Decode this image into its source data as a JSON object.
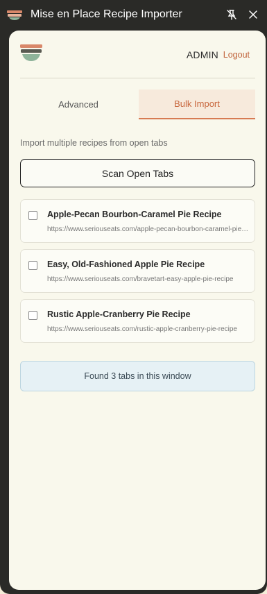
{
  "window": {
    "title": "Mise en Place Recipe Importer"
  },
  "header": {
    "user": "ADMIN",
    "logout_label": "Logout"
  },
  "tabs": [
    {
      "label": "Advanced",
      "active": false
    },
    {
      "label": "Bulk Import",
      "active": true
    }
  ],
  "bulk": {
    "intro": "Import multiple recipes from open tabs",
    "scan_label": "Scan Open Tabs",
    "tabs_found": [
      {
        "title": "Apple-Pecan Bourbon-Caramel Pie Recipe",
        "url": "https://www.seriouseats.com/apple-pecan-bourbon-caramel-pie-recipe",
        "checked": false
      },
      {
        "title": "Easy, Old-Fashioned Apple Pie Recipe",
        "url": "https://www.seriouseats.com/bravetart-easy-apple-pie-recipe",
        "checked": false
      },
      {
        "title": "Rustic Apple-Cranberry Pie Recipe",
        "url": "https://www.seriouseats.com/rustic-apple-cranberry-pie-recipe",
        "checked": false
      }
    ],
    "status": "Found 3 tabs in this window"
  },
  "icons": {
    "logo": "bowl-stack-icon",
    "pin": "unpin-icon",
    "close": "close-icon"
  },
  "colors": {
    "accent": "#c8673e",
    "frame": "#2a2a27",
    "panel": "#f9f8ec",
    "info_bg": "#e6f1f5"
  }
}
